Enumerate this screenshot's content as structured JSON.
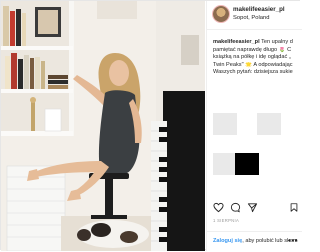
{
  "post": {
    "username": "makelifeeasier_pl",
    "location": "Sopot, Poland",
    "caption": {
      "user": "makelifeeasier_pl",
      "lines": [
        "Ten upalny d",
        "pamiętać naprawdę długo 🌷 C",
        "książką na półkę i idę oglądać „",
        "Twin Peaks\" 🌟 A odpowiadając",
        "Waszych pytań: dzisiejsza sukie"
      ]
    },
    "date": "1 SIERPNIA",
    "footer": {
      "login_link": "Zaloguj się",
      "login_rest": ", aby polubić lub skom"
    },
    "more_label": "•••"
  },
  "icons": [
    "heart-icon",
    "comment-icon",
    "share-icon",
    "bookmark-icon"
  ]
}
